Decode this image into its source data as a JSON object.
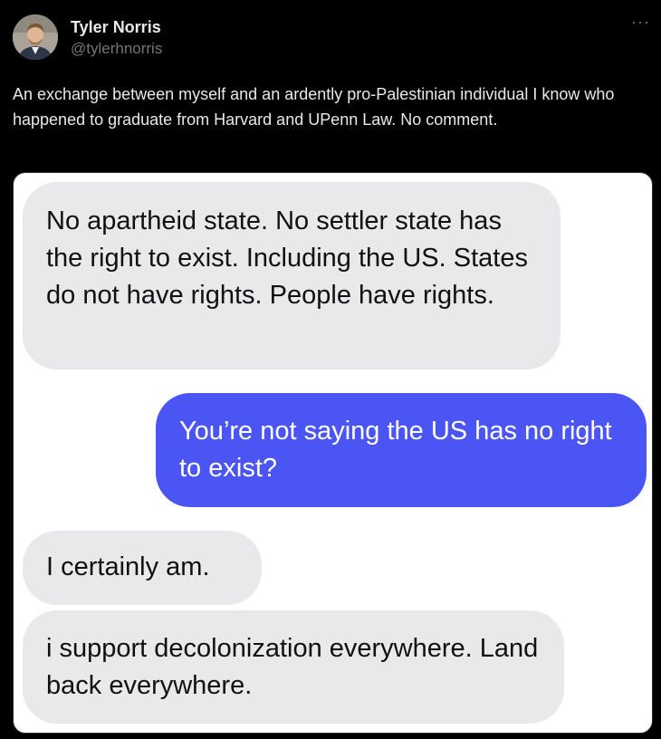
{
  "author": {
    "display_name": "Tyler Norris",
    "handle": "@tylerhnorris"
  },
  "more_icon": "more-horizontal-icon",
  "more_glyph": "···",
  "tweet_text": "An exchange between myself and an ardently pro-Palestinian individual I know who happened to graduate from Harvard and UPenn Law. No comment.",
  "conversation": [
    {
      "sender": "other",
      "text": "No apartheid state. No settler state has the right to exist. Including the US. States do not have rights. People have rights."
    },
    {
      "sender": "self",
      "text": "You’re not saying the US has no right to exist?"
    },
    {
      "sender": "other",
      "text": "I certainly am."
    },
    {
      "sender": "other",
      "text": "i support decolonization everywhere. Land back everywhere."
    }
  ],
  "colors": {
    "background": "#000000",
    "sent_bubble": "#4a55f3",
    "received_bubble": "#e9e9eb"
  }
}
